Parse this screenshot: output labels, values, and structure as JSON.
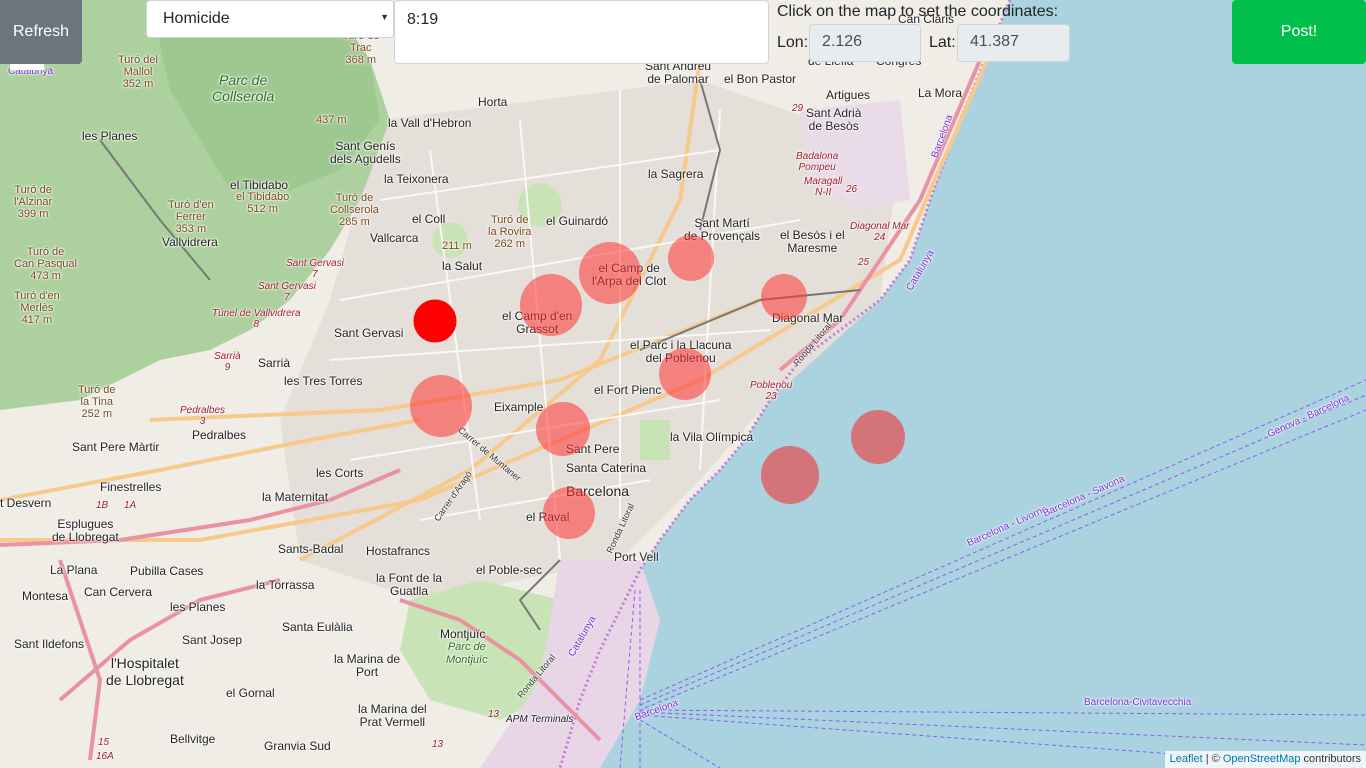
{
  "toolbar": {
    "refresh_label": "Refresh",
    "crime_type_selected": "Homicide",
    "time_value": "8:19",
    "instruction": "Click on the map to set the coordinates:",
    "lon_label": "Lon:",
    "lon_value": "2.126",
    "lat_label": "Lat:",
    "lat_value": "41.387",
    "post_label": "Post!"
  },
  "attribution": {
    "leaflet": "Leaflet",
    "sep": " | © ",
    "osm": "OpenStreetMap",
    "suffix": " contributors"
  },
  "map": {
    "labels": {
      "catalunya_top": "Catalunya",
      "turo_mallol": "Turó del\nMallol\n352 m",
      "turo_trac": "Turó de\nTrac\n368 m",
      "parc_collserola": "Parc de\nCollserola",
      "alt_437": "437 m",
      "horta": "Horta",
      "sant_andreu": "Sant Andreu\nde Palomar",
      "bon_pastor": "el Bon Pastor",
      "vall_hebron": "la Vall d'Hebron",
      "les_planes_n": "les Planes",
      "sant_genis": "Sant Genís\ndels Agudells",
      "la_teixonera": "la Teixonera",
      "la_sagrera": "la Sagrera",
      "artigues": "Artigues",
      "sant_adria": "Sant Adrià\nde Besòs",
      "la_mora": "La Mora",
      "congres": "Congrés",
      "llefia": "de Llefià",
      "can_claris": "Can Claris",
      "tibidabo": "el Tibidabo",
      "tibidabo_peak": "el Tibidabo\n512 m",
      "turo_ferrer": "Turó d'en\nFerrer\n353 m",
      "turo_collserola": "Turó de\nCollserola\n285 m",
      "el_coll": "el Coll",
      "vallcarca": "Vallcarca",
      "alt_211": "211 m",
      "turo_rovira": "Turó de\nla Rovira\n262 m",
      "guinardo": "el Guinardó",
      "sant_marti": "Sant Martí\nde Provençals",
      "besos_maresme": "el Besòs i el\nMaresme",
      "vallvidrera": "Vallvidrera",
      "la_salut": "la Salut",
      "camp_arpa": "el Camp de\nl'Arpa del Clot",
      "sant_gervasi_r1": "Sant Gervasi\n7",
      "sant_gervasi_r2": "Sant Gervasi\n7",
      "tunel_vallvidrera": "Túnel de Vallvidrera\n8",
      "camp_grassot": "el Camp d'en\nGrassot",
      "diagonal_mar": "Diagonal Mar",
      "diagonal_mar_r": "Diagonal Mar\n24",
      "badalona_r": "Badalona\nPompeu",
      "maragall_r": "Maragall\nN-II",
      "turo_alzinar": "Turó de\nl'Alzinar\n399 m",
      "turo_pasqual": "Turó de\nCan Pasqual\n473 m",
      "turo_merles": "Turó d'en\nMerlès\n417 m",
      "sant_gervasi": "Sant Gervasi",
      "sarria": "Sarrià",
      "sarria_r": "Sarrià\n9",
      "parc_llacuna": "el Parc i la Llacuna\ndel Poblenou",
      "ronda_litoral_ne": "Ronda Litoral",
      "les_tres_torres": "les Tres Torres",
      "fort_pienc": "el Fort Pienc",
      "poblenou_r": "Poblenou\n23",
      "turo_tina": "Turó de\nla Tina\n252 m",
      "pedralbes_r": "Pedralbes\n3",
      "pedralbes": "Pedralbes",
      "eixample": "Eixample",
      "vila_olimpica": "la Vila Olímpica",
      "carrer_muntaner": "Carrer de Muntaner",
      "sant_pere_martir": "Sant Pere Màrtir",
      "sant_pere": "Sant Pere",
      "santa_caterina": "Santa Caterina",
      "les_corts": "les Corts",
      "barcelona": "Barcelona",
      "finestrelles": "Finestrelles",
      "la_maternitat": "la Maternitat",
      "carrer_arago": "Carrer d'Aragó",
      "desvern": "t Desvern",
      "esplugues": "Esplugues\nde Llobregat",
      "el_raval": "el Raval",
      "ronda_litoral_c": "Ronda Litoral",
      "sants_badal": "Sants-Badal",
      "hostafrancs": "Hostafrancs",
      "port_vell": "Port Vell",
      "la_plana": "La Plana",
      "pubilla_cases": "Pubilla Cases",
      "la_torrassa": "la Torrassa",
      "la_font_guatlla": "la Font de la\nGuatlla",
      "el_poble_sec": "el Poble-sec",
      "montesa": "Montesa",
      "can_cervera": "Can Cervera",
      "les_planes_s": "les Planes",
      "santa_eulalia": "Santa Eulàlia",
      "sant_josep": "Sant Josep",
      "montjuic": "Montjuïc",
      "parc_montjuic": "Parc de\nMontjuïc",
      "sant_ildefons": "Sant Ildefons",
      "hospitalet": "l'Hospitalet\nde Llobregat",
      "marina_port": "la Marina de\nPort",
      "ronda_litoral_s": "Ronda Litoral",
      "catalunya_port": "Catalunya",
      "el_gornal": "el Gornal",
      "marina_prat": "la Marina del\nPrat Vermell",
      "apm_terminals": "APM Terminals",
      "bellvitge": "Bellvitge",
      "granvia_sud": "Granvia Sud",
      "catalunya_coast": "Catalunya",
      "barcelona_coast": "Barcelona",
      "genova": "Genova - Barcelona",
      "livorno": "Barcelona - Livorno",
      "savona": "Barcelona - Savona",
      "civitavecchia": "Barcelona-Civitavecchia",
      "barcelona_port": "Barcelona",
      "n29": "29",
      "n26": "26",
      "n25": "25",
      "n13a": "13",
      "n13b": "13",
      "n15": "15",
      "n16a": "16A",
      "n1b": "1B",
      "n1a": "1A"
    },
    "markers": [
      {
        "name": "Homicide",
        "color": "#ff0000",
        "opacity": 1.0
      },
      {
        "name": "cluster",
        "color": "#f03",
        "opacity": 0.5
      }
    ]
  }
}
